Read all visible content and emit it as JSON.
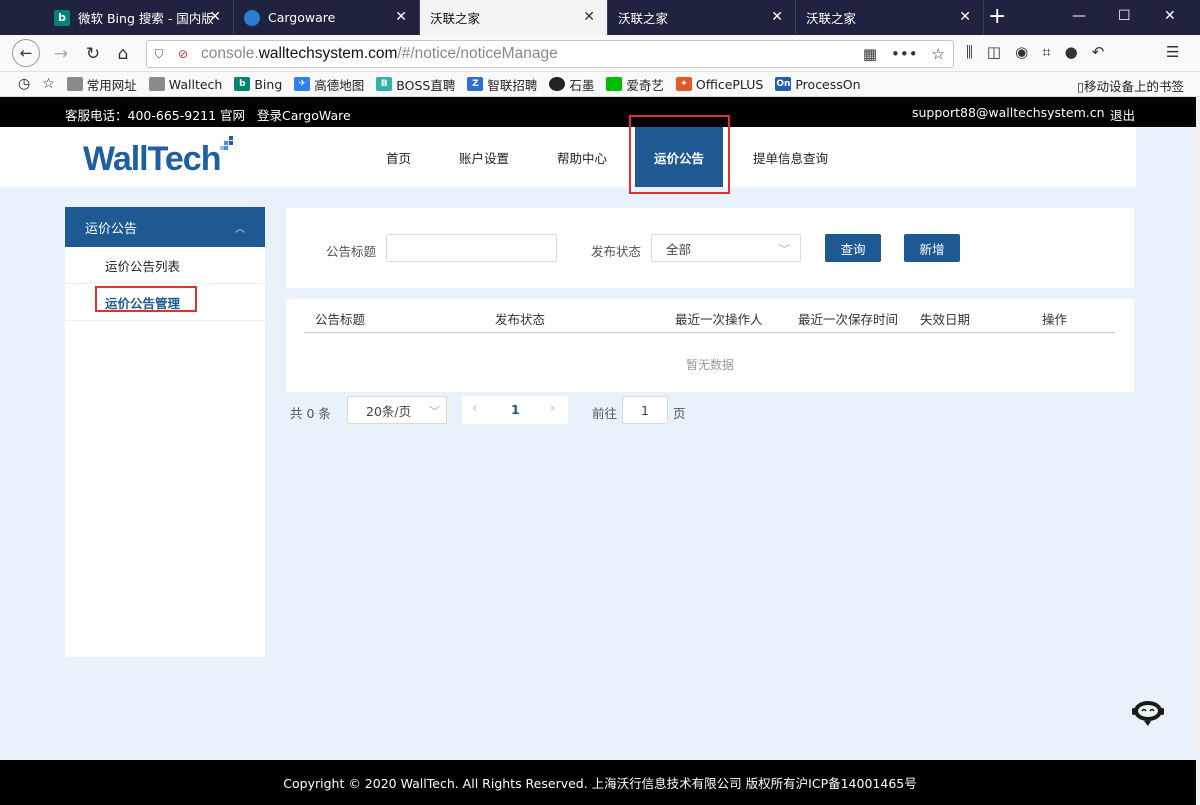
{
  "browser": {
    "tabs": [
      {
        "title": "微软 Bing 搜索 - 国内版",
        "icon": "bing-icon",
        "color": "#008373"
      },
      {
        "title": "Cargoware",
        "icon": "cargoware-icon",
        "color": "#2a7fd4"
      },
      {
        "title": "沃联之家",
        "icon": "",
        "color": ""
      },
      {
        "title": "沃联之家",
        "icon": "",
        "color": ""
      },
      {
        "title": "沃联之家",
        "icon": "",
        "color": ""
      }
    ],
    "url_prefix": "console.",
    "url_domain": "walltechsystem.com",
    "url_suffix": "/#/notice/noticeManage",
    "bookmarks": [
      {
        "label": "常用网址",
        "icon": "folder-icon",
        "color": "#8a8a8a"
      },
      {
        "label": "Walltech",
        "icon": "folder-icon",
        "color": "#8a8a8a"
      },
      {
        "label": "Bing",
        "icon": "bing-icon",
        "color": "#008373"
      },
      {
        "label": "高德地图",
        "icon": "amap-icon",
        "color": "#2f80ed"
      },
      {
        "label": "BOSS直聘",
        "icon": "boss-icon",
        "color": "#32b3a8"
      },
      {
        "label": "智联招聘",
        "icon": "zhilian-icon",
        "color": "#2f6fd0"
      },
      {
        "label": "石墨",
        "icon": "shimo-icon",
        "color": "#222222"
      },
      {
        "label": "爱奇艺",
        "icon": "iqiyi-icon",
        "color": "#00be06"
      },
      {
        "label": "OfficePLUS",
        "icon": "officeplus-icon",
        "color": "#e05a2a"
      },
      {
        "label": "ProcessOn",
        "icon": "processon-icon",
        "color": "#1f5fb0"
      }
    ],
    "mobile_bookmarks": "移动设备上的书签"
  },
  "topbar": {
    "phone": "客服电话：400-665-9211",
    "website": "官网",
    "login": "登录CargoWare",
    "email": "support88@walltechsystem.cn",
    "logout": "退出"
  },
  "header": {
    "logo": "WallTech",
    "nav": [
      "首页",
      "账户设置",
      "帮助中心",
      "运价公告",
      "提单信息查询"
    ],
    "active_color": "#1f5994"
  },
  "sidebar": {
    "title": "运价公告",
    "items": [
      "运价公告列表",
      "运价公告管理"
    ]
  },
  "filter": {
    "title_label": "公告标题",
    "title_value": "",
    "status_label": "发布状态",
    "status_value": "全部",
    "query_button": "查询",
    "add_button": "新增"
  },
  "table": {
    "columns": [
      "公告标题",
      "发布状态",
      "最近一次操作人",
      "最近一次保存时间",
      "失效日期",
      "操作"
    ],
    "empty_text": "暂无数据"
  },
  "pagination": {
    "total": "共 0 条",
    "page_size": "20条/页",
    "current_page": "1",
    "goto_label": "前往",
    "goto_value": "1",
    "page_unit": "页"
  },
  "footer": {
    "copyright": "Copyright © 2020 WallTech. All Rights Reserved. 上海沃行信息技术有限公司 版权所有沪ICP备14001465号"
  }
}
